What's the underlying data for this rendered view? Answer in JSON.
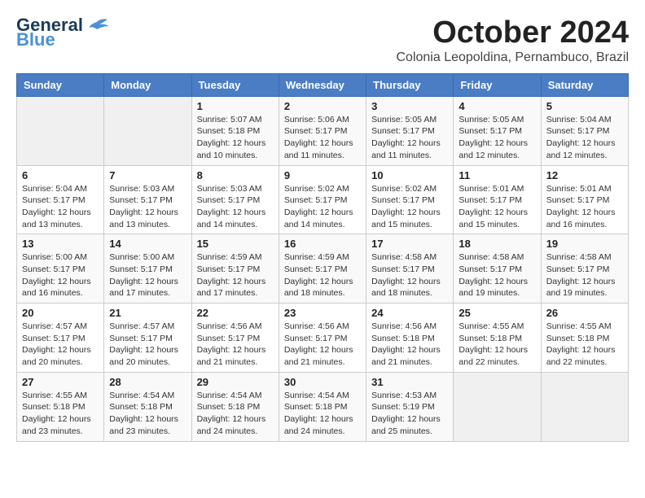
{
  "logo": {
    "line1": "General",
    "line2": "Blue"
  },
  "title": "October 2024",
  "subtitle": "Colonia Leopoldina, Pernambuco, Brazil",
  "days_of_week": [
    "Sunday",
    "Monday",
    "Tuesday",
    "Wednesday",
    "Thursday",
    "Friday",
    "Saturday"
  ],
  "weeks": [
    [
      {
        "day": "",
        "info": ""
      },
      {
        "day": "",
        "info": ""
      },
      {
        "day": "1",
        "info": "Sunrise: 5:07 AM\nSunset: 5:18 PM\nDaylight: 12 hours\nand 10 minutes."
      },
      {
        "day": "2",
        "info": "Sunrise: 5:06 AM\nSunset: 5:17 PM\nDaylight: 12 hours\nand 11 minutes."
      },
      {
        "day": "3",
        "info": "Sunrise: 5:05 AM\nSunset: 5:17 PM\nDaylight: 12 hours\nand 11 minutes."
      },
      {
        "day": "4",
        "info": "Sunrise: 5:05 AM\nSunset: 5:17 PM\nDaylight: 12 hours\nand 12 minutes."
      },
      {
        "day": "5",
        "info": "Sunrise: 5:04 AM\nSunset: 5:17 PM\nDaylight: 12 hours\nand 12 minutes."
      }
    ],
    [
      {
        "day": "6",
        "info": "Sunrise: 5:04 AM\nSunset: 5:17 PM\nDaylight: 12 hours\nand 13 minutes."
      },
      {
        "day": "7",
        "info": "Sunrise: 5:03 AM\nSunset: 5:17 PM\nDaylight: 12 hours\nand 13 minutes."
      },
      {
        "day": "8",
        "info": "Sunrise: 5:03 AM\nSunset: 5:17 PM\nDaylight: 12 hours\nand 14 minutes."
      },
      {
        "day": "9",
        "info": "Sunrise: 5:02 AM\nSunset: 5:17 PM\nDaylight: 12 hours\nand 14 minutes."
      },
      {
        "day": "10",
        "info": "Sunrise: 5:02 AM\nSunset: 5:17 PM\nDaylight: 12 hours\nand 15 minutes."
      },
      {
        "day": "11",
        "info": "Sunrise: 5:01 AM\nSunset: 5:17 PM\nDaylight: 12 hours\nand 15 minutes."
      },
      {
        "day": "12",
        "info": "Sunrise: 5:01 AM\nSunset: 5:17 PM\nDaylight: 12 hours\nand 16 minutes."
      }
    ],
    [
      {
        "day": "13",
        "info": "Sunrise: 5:00 AM\nSunset: 5:17 PM\nDaylight: 12 hours\nand 16 minutes."
      },
      {
        "day": "14",
        "info": "Sunrise: 5:00 AM\nSunset: 5:17 PM\nDaylight: 12 hours\nand 17 minutes."
      },
      {
        "day": "15",
        "info": "Sunrise: 4:59 AM\nSunset: 5:17 PM\nDaylight: 12 hours\nand 17 minutes."
      },
      {
        "day": "16",
        "info": "Sunrise: 4:59 AM\nSunset: 5:17 PM\nDaylight: 12 hours\nand 18 minutes."
      },
      {
        "day": "17",
        "info": "Sunrise: 4:58 AM\nSunset: 5:17 PM\nDaylight: 12 hours\nand 18 minutes."
      },
      {
        "day": "18",
        "info": "Sunrise: 4:58 AM\nSunset: 5:17 PM\nDaylight: 12 hours\nand 19 minutes."
      },
      {
        "day": "19",
        "info": "Sunrise: 4:58 AM\nSunset: 5:17 PM\nDaylight: 12 hours\nand 19 minutes."
      }
    ],
    [
      {
        "day": "20",
        "info": "Sunrise: 4:57 AM\nSunset: 5:17 PM\nDaylight: 12 hours\nand 20 minutes."
      },
      {
        "day": "21",
        "info": "Sunrise: 4:57 AM\nSunset: 5:17 PM\nDaylight: 12 hours\nand 20 minutes."
      },
      {
        "day": "22",
        "info": "Sunrise: 4:56 AM\nSunset: 5:17 PM\nDaylight: 12 hours\nand 21 minutes."
      },
      {
        "day": "23",
        "info": "Sunrise: 4:56 AM\nSunset: 5:17 PM\nDaylight: 12 hours\nand 21 minutes."
      },
      {
        "day": "24",
        "info": "Sunrise: 4:56 AM\nSunset: 5:18 PM\nDaylight: 12 hours\nand 21 minutes."
      },
      {
        "day": "25",
        "info": "Sunrise: 4:55 AM\nSunset: 5:18 PM\nDaylight: 12 hours\nand 22 minutes."
      },
      {
        "day": "26",
        "info": "Sunrise: 4:55 AM\nSunset: 5:18 PM\nDaylight: 12 hours\nand 22 minutes."
      }
    ],
    [
      {
        "day": "27",
        "info": "Sunrise: 4:55 AM\nSunset: 5:18 PM\nDaylight: 12 hours\nand 23 minutes."
      },
      {
        "day": "28",
        "info": "Sunrise: 4:54 AM\nSunset: 5:18 PM\nDaylight: 12 hours\nand 23 minutes."
      },
      {
        "day": "29",
        "info": "Sunrise: 4:54 AM\nSunset: 5:18 PM\nDaylight: 12 hours\nand 24 minutes."
      },
      {
        "day": "30",
        "info": "Sunrise: 4:54 AM\nSunset: 5:18 PM\nDaylight: 12 hours\nand 24 minutes."
      },
      {
        "day": "31",
        "info": "Sunrise: 4:53 AM\nSunset: 5:19 PM\nDaylight: 12 hours\nand 25 minutes."
      },
      {
        "day": "",
        "info": ""
      },
      {
        "day": "",
        "info": ""
      }
    ]
  ]
}
